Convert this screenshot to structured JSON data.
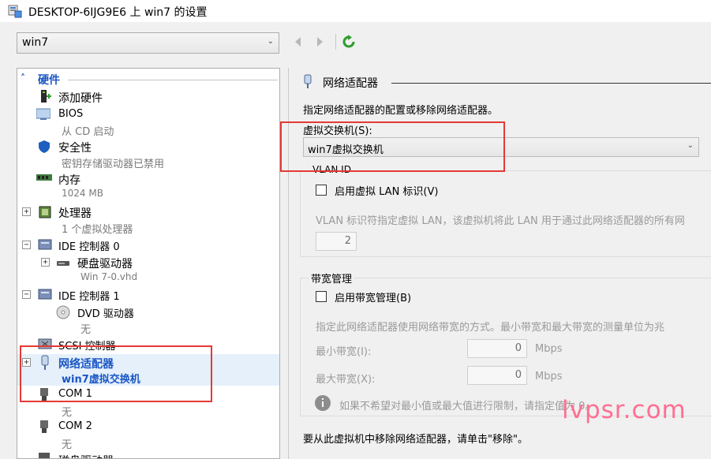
{
  "window": {
    "title": "DESKTOP-6IJG9E6 上 win7 的设置"
  },
  "toolbar": {
    "vm_selected": "win7"
  },
  "tree": {
    "section_label": "硬件",
    "add_hardware": "添加硬件",
    "bios": {
      "label": "BIOS",
      "sub": "从 CD 启动"
    },
    "security": {
      "label": "安全性",
      "sub": "密钥存储驱动器已禁用"
    },
    "memory": {
      "label": "内存",
      "sub": "1024 MB"
    },
    "processor": {
      "label": "处理器",
      "sub": "1 个虚拟处理器"
    },
    "ide0": {
      "label": "IDE 控制器 0"
    },
    "hdd": {
      "label": "硬盘驱动器",
      "sub": "Win 7-0.vhd"
    },
    "ide1": {
      "label": "IDE 控制器 1"
    },
    "dvd": {
      "label": "DVD 驱动器",
      "sub": "无"
    },
    "scsi": {
      "label": "SCSI 控制器"
    },
    "network": {
      "label": "网络适配器",
      "sub": "win7虚拟交换机"
    },
    "com1": {
      "label": "COM 1",
      "sub": "无"
    },
    "com2": {
      "label": "COM 2",
      "sub": "无"
    },
    "floppy": {
      "label": "磁盘驱动器"
    }
  },
  "panel": {
    "heading": "网络适配器",
    "description": "指定网络适配器的配置或移除网络适配器。",
    "switch_label": "虚拟交换机(S):",
    "switch_value": "win7虚拟交换机",
    "vlan_group": "VLAN ID",
    "vlan_checkbox": "启用虚拟 LAN 标识(V)",
    "vlan_desc": "VLAN 标识符指定虚拟 LAN，该虚拟机将此 LAN 用于通过此网络适配器的所有网",
    "vlan_value": "2",
    "bw_group": "带宽管理",
    "bw_checkbox": "启用带宽管理(B)",
    "bw_desc": "指定此网络适配器使用网络带宽的方式。最小带宽和最大带宽的测量单位为兆",
    "min_label": "最小带宽(I):",
    "min_value": "0",
    "max_label": "最大带宽(X):",
    "max_value": "0",
    "unit": "Mbps",
    "info_text": "如果不希望对最小值或最大值进行限制，请指定值为 0。",
    "remove_text": "要从此虚拟机中移除网络适配器，请单击\"移除\"。"
  },
  "watermark": "lvpsr.com",
  "colors": {
    "accent_blue": "#1a56c4",
    "highlight_red": "#e53935",
    "watermark_pink": "#ff6f91"
  }
}
